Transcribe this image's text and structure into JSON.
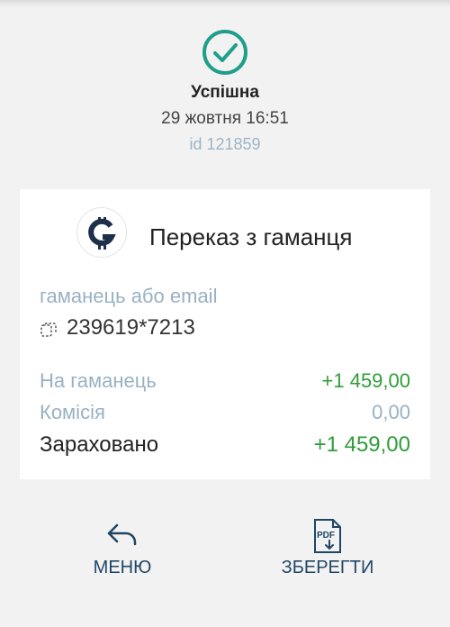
{
  "status": {
    "title": "Успішна",
    "date": "29 жовтня 16:51",
    "id": "id 121859",
    "icon": "check-circle-icon",
    "accent_color": "#1f9e8a"
  },
  "card": {
    "title": "Переказ з гаманця",
    "logo_icon": "gamancy-logo-icon",
    "wallet_label": "гаманець або email",
    "wallet_value": "239619*7213",
    "rows": [
      {
        "label": "На гаманець",
        "value": "+1 459,00"
      },
      {
        "label": "Комісія",
        "value": "0,00"
      }
    ],
    "total": {
      "label": "Зараховано",
      "value": "+1 459,00"
    }
  },
  "actions": {
    "menu_label": "МЕНЮ",
    "save_label": "ЗБЕРЕГТИ",
    "menu_icon": "reply-arrow-icon",
    "save_icon": "pdf-download-icon"
  },
  "colors": {
    "positive": "#2e9d3a",
    "muted": "#98b1c4",
    "button_text": "#1f4666"
  }
}
